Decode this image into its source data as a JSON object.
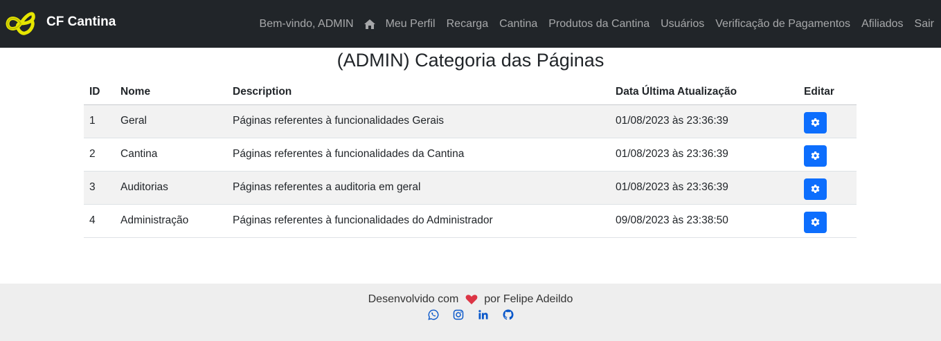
{
  "navbar": {
    "brand": "CF Cantina",
    "items": [
      {
        "label": "Bem-vindo, ADMIN"
      },
      {
        "icon": "home-icon"
      },
      {
        "label": "Meu Perfil"
      },
      {
        "label": "Recarga"
      },
      {
        "label": "Cantina"
      },
      {
        "label": "Produtos da Cantina"
      },
      {
        "label": "Usuários"
      },
      {
        "label": "Verificação de Pagamentos"
      },
      {
        "label": "Afiliados"
      },
      {
        "label": "Sair"
      }
    ]
  },
  "page": {
    "title": "(ADMIN) Categoria das Páginas"
  },
  "table": {
    "headers": [
      "ID",
      "Nome",
      "Description",
      "Data Última Atualização",
      "Editar"
    ],
    "rows": [
      {
        "id": "1",
        "nome": "Geral",
        "description": "Páginas referentes à funcionalidades Gerais",
        "data": "01/08/2023 às 23:36:39",
        "edit_icon": "gear-icon"
      },
      {
        "id": "2",
        "nome": "Cantina",
        "description": "Páginas referentes à funcionalidades da Cantina",
        "data": "01/08/2023 às 23:36:39",
        "edit_icon": "gear-icon"
      },
      {
        "id": "3",
        "nome": "Auditorias",
        "description": "Páginas referentes a auditoria em geral",
        "data": "01/08/2023 às 23:36:39",
        "edit_icon": "gear-icon"
      },
      {
        "id": "4",
        "nome": "Administração",
        "description": "Páginas referentes à funcionalidades do Administrador",
        "data": "09/08/2023 às 23:38:50",
        "edit_icon": "gear-icon"
      }
    ]
  },
  "footer": {
    "text_before": "Desenvolvido com",
    "text_after": "por Felipe Adeildo",
    "heart_icon": "heart-icon",
    "social_icons": [
      "whatsapp-icon",
      "instagram-icon",
      "linkedin-icon",
      "github-icon"
    ]
  },
  "colors": {
    "navbar_bg": "#212529",
    "brand_logo": "#e6e600",
    "button_primary": "#0d6efd",
    "footer_bg": "#eeeeee",
    "social_icon": "#0a58ca",
    "heart": "#dc3545"
  }
}
